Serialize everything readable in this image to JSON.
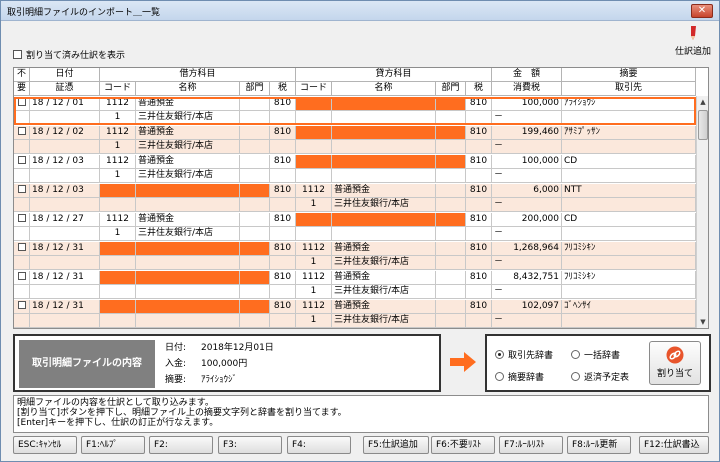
{
  "window": {
    "title": "取引明細ファイルのインポート＿一覧",
    "close": "✕"
  },
  "toolbar": {
    "show_assigned_label": "割り当て済み仕訳を表示",
    "add_journal_label": "仕訳追加"
  },
  "grid": {
    "header_top": [
      "不",
      "日付",
      "借方科目",
      "貸方科目",
      "金　額",
      "摘要"
    ],
    "header_bottom": [
      "要",
      "証憑",
      "コード",
      "名称",
      "部門",
      "税",
      "コード",
      "名称",
      "部門",
      "税",
      "消費税",
      "取引先"
    ],
    "rows": [
      {
        "date": "18 / 12 / 01",
        "dr_code": "1112",
        "dr_name": "普通預金",
        "dr_tax": "810",
        "cr_code": "",
        "cr_name": "",
        "cr_tax": "810",
        "amount": "100,000",
        "partner": "ｱﾗｲｼｮｳｼﾞ",
        "dr_sub_code": "1",
        "dr_sub_name": "三井住友銀行/本店",
        "cr_sub_code": "",
        "cr_sub_name": "",
        "tax_sub": "－"
      },
      {
        "date": "18 / 12 / 02",
        "dr_code": "1112",
        "dr_name": "普通預金",
        "dr_tax": "810",
        "cr_code": "",
        "cr_name": "",
        "cr_tax": "810",
        "amount": "199,460",
        "partner": "ｱｻﾐﾌﾟｯｻﾝ",
        "dr_sub_code": "1",
        "dr_sub_name": "三井住友銀行/本店",
        "cr_sub_code": "",
        "cr_sub_name": "",
        "tax_sub": "－"
      },
      {
        "date": "18 / 12 / 03",
        "dr_code": "1112",
        "dr_name": "普通預金",
        "dr_tax": "810",
        "cr_code": "",
        "cr_name": "",
        "cr_tax": "810",
        "amount": "100,000",
        "partner": "CD",
        "dr_sub_code": "1",
        "dr_sub_name": "三井住友銀行/本店",
        "cr_sub_code": "",
        "cr_sub_name": "",
        "tax_sub": "－"
      },
      {
        "date": "18 / 12 / 03",
        "dr_code": "",
        "dr_name": "",
        "dr_tax": "810",
        "cr_code": "1112",
        "cr_name": "普通預金",
        "cr_tax": "810",
        "amount": "6,000",
        "partner": "NTT",
        "dr_sub_code": "",
        "dr_sub_name": "",
        "cr_sub_code": "1",
        "cr_sub_name": "三井住友銀行/本店",
        "tax_sub": "－"
      },
      {
        "date": "18 / 12 / 27",
        "dr_code": "1112",
        "dr_name": "普通預金",
        "dr_tax": "810",
        "cr_code": "",
        "cr_name": "",
        "cr_tax": "810",
        "amount": "200,000",
        "partner": "CD",
        "dr_sub_code": "1",
        "dr_sub_name": "三井住友銀行/本店",
        "cr_sub_code": "",
        "cr_sub_name": "",
        "tax_sub": "－"
      },
      {
        "date": "18 / 12 / 31",
        "dr_code": "",
        "dr_name": "",
        "dr_tax": "810",
        "cr_code": "1112",
        "cr_name": "普通預金",
        "cr_tax": "810",
        "amount": "1,268,964",
        "partner": "ﾌﾘｺﾐｼｷﾝ",
        "dr_sub_code": "",
        "dr_sub_name": "",
        "cr_sub_code": "1",
        "cr_sub_name": "三井住友銀行/本店",
        "tax_sub": "－"
      },
      {
        "date": "18 / 12 / 31",
        "dr_code": "",
        "dr_name": "",
        "dr_tax": "810",
        "cr_code": "1112",
        "cr_name": "普通預金",
        "cr_tax": "810",
        "amount": "8,432,751",
        "partner": "ﾌﾘｺﾐｼｷﾝ",
        "dr_sub_code": "",
        "dr_sub_name": "",
        "cr_sub_code": "1",
        "cr_sub_name": "三井住友銀行/本店",
        "tax_sub": "－"
      },
      {
        "date": "18 / 12 / 31",
        "dr_code": "",
        "dr_name": "",
        "dr_tax": "810",
        "cr_code": "1112",
        "cr_name": "普通預金",
        "cr_tax": "810",
        "amount": "102,097",
        "partner": "ｺﾞﾍﾝｻｲ",
        "dr_sub_code": "",
        "dr_sub_name": "",
        "cr_sub_code": "1",
        "cr_sub_name": "三井住友銀行/本店",
        "tax_sub": "－"
      }
    ]
  },
  "detail": {
    "title": "取引明細ファイルの内容",
    "date_label": "日付:",
    "date_value": "2018年12月01日",
    "deposit_label": "入金:",
    "deposit_value": "100,000円",
    "memo_label": "摘要:",
    "memo_value": "ｱﾗｲｼｮｳｼﾞ"
  },
  "assign": {
    "options": [
      "取引先辞書",
      "一括辞書",
      "摘要辞書",
      "返済予定表"
    ],
    "selected": "取引先辞書",
    "button_label": "割り当て"
  },
  "message": [
    "明細ファイルの内容を仕訳として取り込みます。",
    "[割り当て]ボタンを押下し、明細ファイル上の摘要文字列と辞書を割り当てます。",
    "[Enter]キーを押下し、仕訳の訂正が行なえます。"
  ],
  "fkeys": [
    "ESC:ｷｬﾝｾﾙ",
    "F1:ﾍﾙﾌﾟ",
    "F2:",
    "F3:",
    "F4:",
    "F5:仕訳追加",
    "F6:不要ﾘｽﾄ",
    "F7:ﾙｰﾙﾘｽﾄ",
    "F8:ﾙｰﾙ更新",
    "F12:仕訳書込"
  ],
  "colors": {
    "accent": "#ff6d1f",
    "row_tint": "#fbe8dc"
  }
}
